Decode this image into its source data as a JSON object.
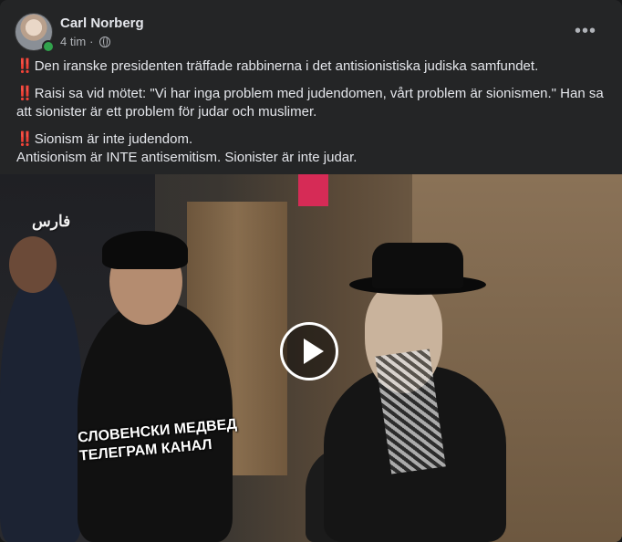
{
  "post": {
    "author": "Carl Norberg",
    "time": "4 tim",
    "separator": "·",
    "privacy_icon": "globe-icon",
    "more_icon": "more-options-icon",
    "more_label": "•••",
    "paragraphs": [
      {
        "mark": "‼️",
        "text": "Den iranske presidenten träffade rabbinerna i det antisionistiska judiska samfundet."
      },
      {
        "mark": "‼️",
        "text": "Raisi sa vid mötet: \"Vi har inga problem med judendomen, vårt problem är sionismen.\" Han sa att sionister är ett problem för judar och muslimer."
      },
      {
        "mark": "‼️",
        "text": "Sionism är inte judendom.",
        "line2": "Antisionism är INTE antisemitism. Sionister är inte judar."
      }
    ]
  },
  "video": {
    "watermark": "فارس",
    "caption": "СЛОВЕНСКИ МЕДВЕД\nТЕЛЕГРАМ КАНАЛ",
    "play_icon": "play-icon"
  },
  "colors": {
    "background": "#18191a",
    "card": "#242526",
    "text": "#e4e6eb",
    "secondary_text": "#b0b3b8",
    "online": "#31a24c",
    "exclamation": "#e0245e"
  }
}
